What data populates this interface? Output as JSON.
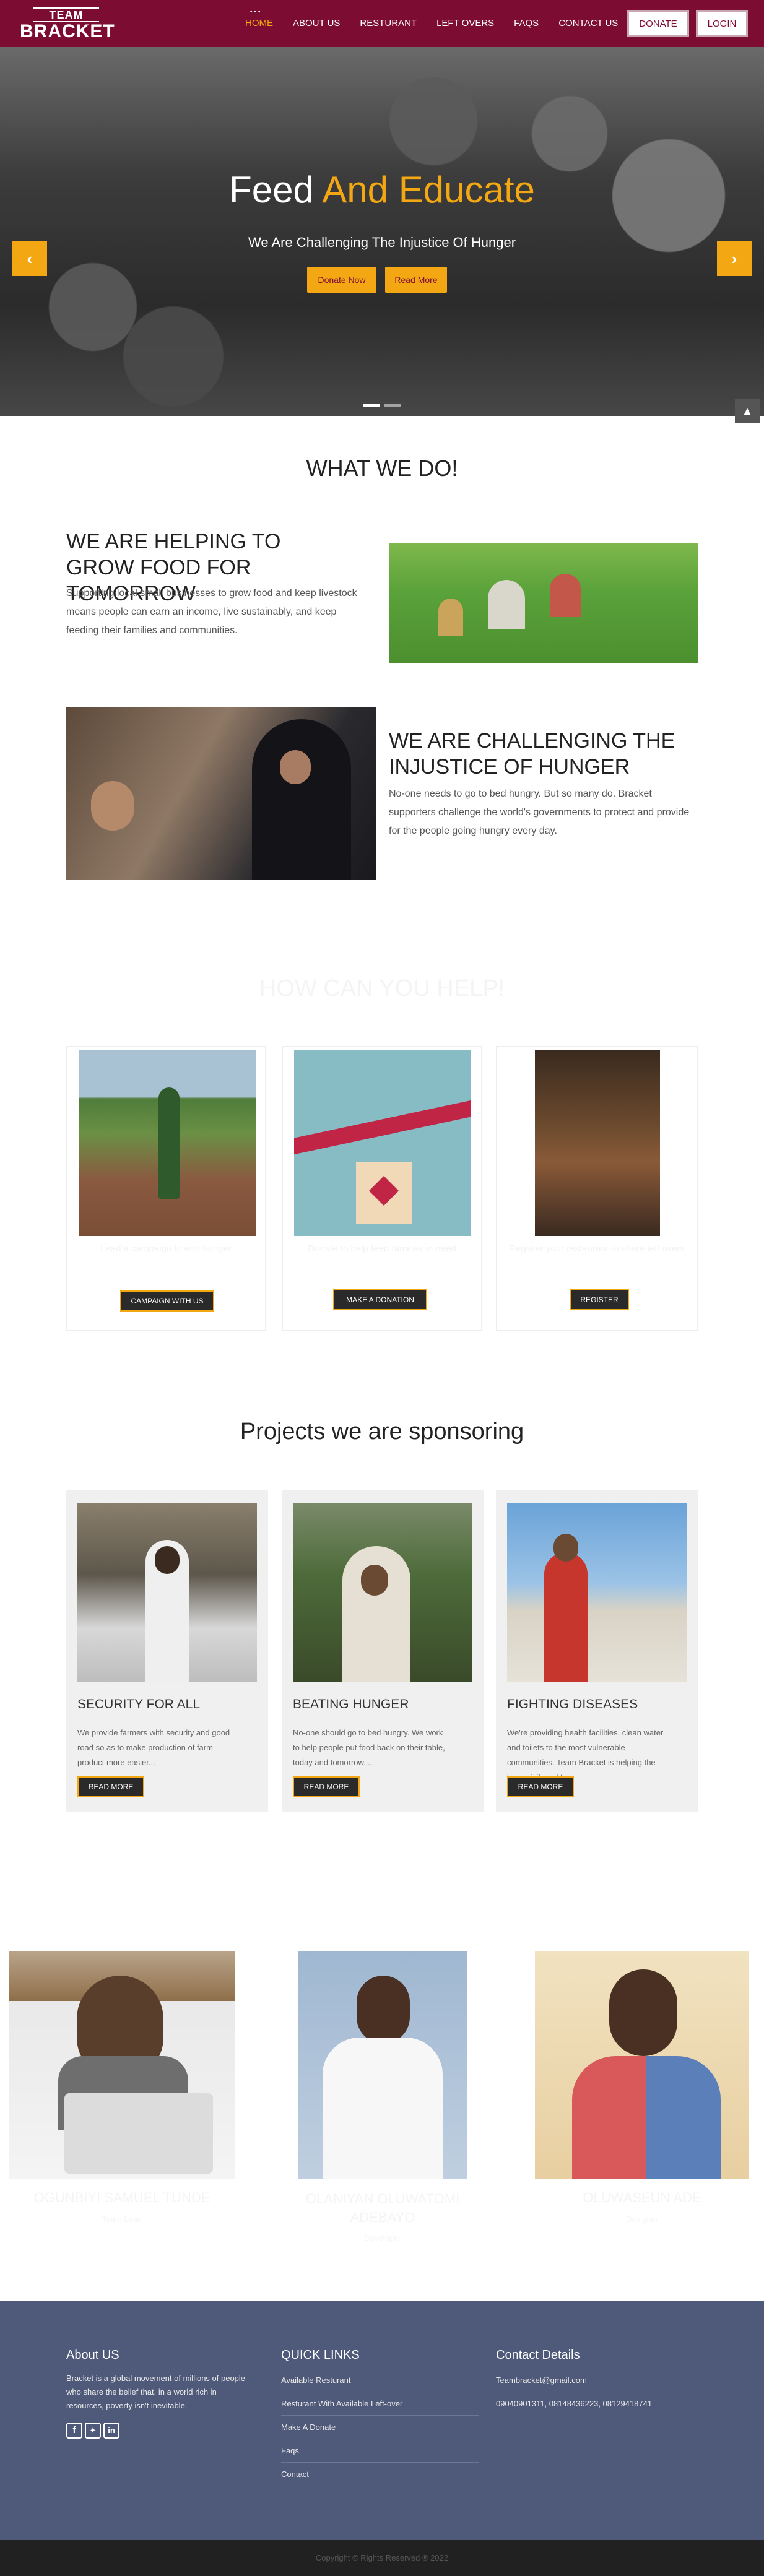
{
  "brand": {
    "line1": "TEAM",
    "line2": "BRACKET"
  },
  "nav": {
    "dots": "•••",
    "items": [
      "HOME",
      "ABOUT US",
      "RESTURANT",
      "LEFT OVERS",
      "FAQS",
      "CONTACT US"
    ],
    "donate": "DONATE",
    "login": "LOGIN"
  },
  "hero": {
    "title_a": "Feed ",
    "title_b": "And Educate",
    "subtitle": "We Are Challenging The Injustice Of Hunger",
    "btn1": "Donate Now",
    "btn2": "Read More",
    "prev": "‹",
    "next": "›",
    "top": "▲"
  },
  "what": {
    "title": "WHAT WE DO!",
    "b1_title": "WE ARE HELPING TO GROW FOOD FOR TOMORROW",
    "b1_text": "Supporting local small businesses to grow food and keep livestock means people can earn an income, live sustainably, and keep feeding their families and communities.",
    "b2_title": "WE ARE CHALLENGING THE INJUSTICE OF HUNGER",
    "b2_text": "No-one needs to go to bed hungry. But so many do. Bracket supporters challenge the world's governments to protect and provide for the people going hungry every day."
  },
  "help": {
    "title": "HOW CAN YOU HELP!",
    "subtitle": "",
    "cards": [
      {
        "caption": "Lead a campaign to end hunger",
        "button": "CAMPAIGN WITH US"
      },
      {
        "caption": "Donate to help feed families in need",
        "button": "MAKE A DONATION"
      },
      {
        "caption": "Register your restaurant to share left overs",
        "button": "REGISTER"
      }
    ]
  },
  "projects": {
    "title": "Projects we are sponsoring",
    "cards": [
      {
        "title": "SECURITY FOR ALL",
        "text": "We provide farmers with security and good road so as to make production of farm product more easier...",
        "button": "READ MORE"
      },
      {
        "title": "BEATING HUNGER",
        "text": "No-one should go to bed hungry. We work to help people put food back on their table, today and tomorrow....",
        "button": "READ MORE"
      },
      {
        "title": "FIGHTING DISEASES",
        "text": "We're providing health facilities, clean water and toilets to the most vulnerable communities. Team Bracket is helping the less privileged to...",
        "button": "READ MORE"
      }
    ]
  },
  "team": [
    {
      "name": "OGUNBIYI SAMUEL TUNDE",
      "role": "Team Lead"
    },
    {
      "name": "OLANIYAN OLUWATOMI ADEBAYO",
      "role": "Developer"
    },
    {
      "name": "OLUWASEUN ADE",
      "role": "Designer"
    }
  ],
  "footer": {
    "about_title": "About US",
    "about_text": "Bracket is a global movement of millions of people who share the belief that, in a world rich in resources, poverty isn't inevitable.",
    "links_title": "QUICK LINKS",
    "links": [
      "Available Resturant",
      "Resturant With Available Left-over",
      "Make A Donate",
      "Faqs",
      "Contact"
    ],
    "contact_title": "Contact Details",
    "email": "Teambracket@gmail.com",
    "phones": "09040901311, 08148436223, 08129418741",
    "copyright": "Copyright © Rights Reserved ® 2022"
  },
  "colors": {
    "primary": "#7d0c33",
    "accent": "#f3a712",
    "footer": "#4f5a7a"
  }
}
